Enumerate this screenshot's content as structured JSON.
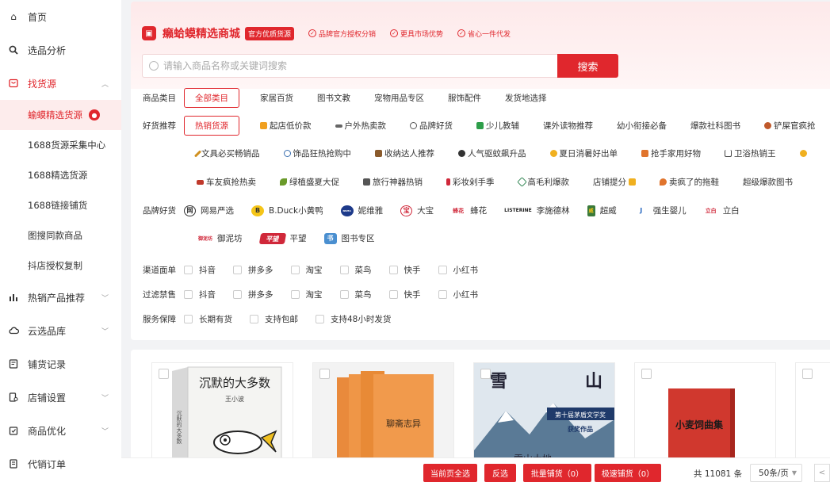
{
  "sidebar": {
    "items": [
      {
        "label": "首页",
        "icon": "home-icon"
      },
      {
        "label": "选品分析",
        "icon": "search-icon"
      },
      {
        "label": "找货源",
        "icon": "store-icon"
      },
      {
        "label": "热销产品推荐",
        "icon": "bar-chart-icon"
      },
      {
        "label": "云选品库",
        "icon": "cloud-icon"
      },
      {
        "label": "铺货记录",
        "icon": "record-icon"
      },
      {
        "label": "店铺设置",
        "icon": "shop-settings-icon"
      },
      {
        "label": "商品优化",
        "icon": "optimize-icon"
      },
      {
        "label": "代销订单",
        "icon": "order-icon"
      }
    ],
    "sub_items": [
      {
        "label": "蝓蟆精选货源"
      },
      {
        "label": "1688货源采集中心"
      },
      {
        "label": "1688精选货源"
      },
      {
        "label": "1688链接铺货"
      },
      {
        "label": "图搜同款商品"
      },
      {
        "label": "抖店授权复制"
      }
    ]
  },
  "header": {
    "brand_name": "癞蛤蟆精选商城",
    "brand_tag": "官方优质货源",
    "features": [
      "品牌官方授权分销",
      "更具市场优势",
      "省心一件代发"
    ]
  },
  "search": {
    "placeholder": "请输入商品名称或关键词搜索",
    "button": "搜索"
  },
  "filters": {
    "category": {
      "label": "商品类目",
      "options": [
        "全部类目",
        "家居百货",
        "图书文教",
        "宠物用品专区",
        "服饰配件",
        "发货地选择"
      ]
    },
    "recommend": {
      "label": "好货推荐",
      "row1": [
        "热销货源",
        "起店低价款",
        "户外热卖款",
        "品牌好货",
        "少儿教辅",
        "课外读物推荐",
        "幼小衔接必备",
        "爆款社科图书",
        "铲屎官疯抢"
      ],
      "row2": [
        "文具必买畅销品",
        "饰品狂热抢购中",
        "收纳达人推荐",
        "人气驱蚊飙升品",
        "夏日消暑好出单",
        "抢手家用好物",
        "卫浴热销王"
      ],
      "row3": [
        "车友疯抢热卖",
        "绿植盛夏大促",
        "旅行神器热销",
        "彩妆剁手季",
        "高毛利爆款",
        "店铺提分",
        "卖疯了的拖鞋",
        "超级爆款图书"
      ]
    },
    "brands": {
      "label": "品牌好货",
      "row1": [
        {
          "name": "网易严选",
          "logo": "网"
        },
        {
          "name": "B.Duck小黄鸭",
          "logo": "B"
        },
        {
          "name": "妮维雅",
          "logo": "NIVEA"
        },
        {
          "name": "大宝",
          "logo": "宝"
        },
        {
          "name": "蜂花",
          "logo": "蜂花"
        },
        {
          "name": "李施德林",
          "logo": "LISTERINE"
        },
        {
          "name": "超威",
          "logo": "威"
        },
        {
          "name": "强生婴儿",
          "logo": "J"
        },
        {
          "name": "立白",
          "logo": "立白"
        }
      ],
      "row2": [
        {
          "name": "御泥坊",
          "logo": "御泥坊"
        },
        {
          "name": "平望",
          "logo": "平望"
        },
        {
          "name": "图书专区",
          "logo": "书"
        }
      ]
    },
    "channel": {
      "label": "渠道面单",
      "options": [
        "抖音",
        "拼多多",
        "淘宝",
        "菜鸟",
        "快手",
        "小红书"
      ]
    },
    "banned": {
      "label": "过滤禁售",
      "options": [
        "抖音",
        "拼多多",
        "淘宝",
        "菜鸟",
        "快手",
        "小红书"
      ]
    },
    "service": {
      "label": "服务保障",
      "options": [
        "长期有货",
        "支持包邮",
        "支持48小时发货"
      ]
    }
  },
  "products": [
    {
      "title": "沉默的大多数",
      "author": "王小波"
    },
    {
      "title": "聊斋志异"
    },
    {
      "title": "雪山大地",
      "banner": "第十届茅盾文学奖",
      "sub": "获奖作品"
    },
    {
      "title": "小麦饲曲集"
    },
    {
      "title": ""
    }
  ],
  "bottom_bar": {
    "select_page": "当前页全选",
    "invert": "反选",
    "batch": "批量铺货（0）",
    "fast": "极速铺货（0）",
    "total": "共 11081 条",
    "page_size": "50条/页",
    "prev": "<"
  },
  "colors": {
    "accent": "#e0272d",
    "active_bg": "#fdecec"
  }
}
